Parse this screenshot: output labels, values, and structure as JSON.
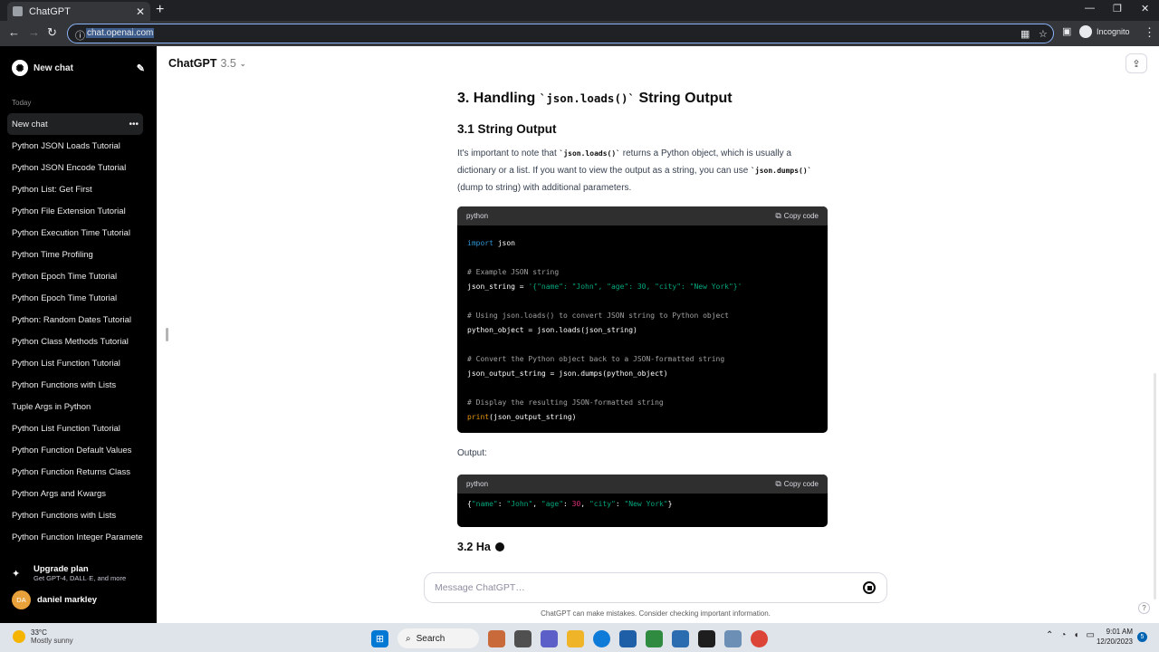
{
  "browser": {
    "tab_title": "ChatGPT",
    "url": "chat.openai.com",
    "profile_label": "Incognito"
  },
  "sidebar": {
    "new_chat_label": "New chat",
    "today_label": "Today",
    "items": [
      {
        "label": "New chat"
      },
      {
        "label": "Python JSON Loads Tutorial"
      },
      {
        "label": "Python JSON Encode Tutorial"
      },
      {
        "label": "Python List: Get First"
      },
      {
        "label": "Python File Extension Tutorial"
      },
      {
        "label": "Python Execution Time Tutorial"
      },
      {
        "label": "Python Time Profiling"
      },
      {
        "label": "Python Epoch Time Tutorial"
      },
      {
        "label": "Python Epoch Time Tutorial"
      },
      {
        "label": "Python: Random Dates Tutorial"
      },
      {
        "label": "Python Class Methods Tutorial"
      },
      {
        "label": "Python List Function Tutorial"
      },
      {
        "label": "Python Functions with Lists"
      },
      {
        "label": "Tuple Args in Python"
      },
      {
        "label": "Python List Function Tutorial"
      },
      {
        "label": "Python Function Default Values"
      },
      {
        "label": "Python Function Returns Class"
      },
      {
        "label": "Python Args and Kwargs"
      },
      {
        "label": "Python Functions with Lists"
      },
      {
        "label": "Python Function Integer Parameter"
      }
    ],
    "upgrade_title": "Upgrade plan",
    "upgrade_subtitle": "Get GPT-4, DALL·E, and more",
    "user_initials": "DA",
    "user_name": "daniel markley"
  },
  "header": {
    "model_name": "ChatGPT",
    "model_version": "3.5"
  },
  "article": {
    "h3_prefix": "3. Handling ",
    "h3_code": "`json.loads()`",
    "h3_suffix": " String Output",
    "h31": "3.1 String Output",
    "p_1": "It's important to note that ",
    "p_code1": "`json.loads()`",
    "p_2": " returns a Python object, which is usually a dictionary or a list. If you want to view the output as a string, you can use ",
    "p_code2": "`json.dumps()`",
    "p_3": " (dump to string) with additional parameters.",
    "output_label": "Output:",
    "h32": "3.2 Ha"
  },
  "code1": {
    "lang": "python",
    "copy_label": "Copy code",
    "l1_kw": "import",
    "l1_rest": " json",
    "l3": "# Example JSON string",
    "l4_a": "json_string = ",
    "l4_str": "'{\"name\": \"John\", \"age\": 30, \"city\": \"New York\"}'",
    "l6": "# Using json.loads() to convert JSON string to Python object",
    "l7": "python_object = json.loads(json_string)",
    "l9": "# Convert the Python object back to a JSON-formatted string",
    "l10": "json_output_string = json.dumps(python_object)",
    "l12": "# Display the resulting JSON-formatted string",
    "l13_fn": "print",
    "l13_rest": "(json_output_string)"
  },
  "code2": {
    "lang": "python",
    "copy_label": "Copy code",
    "o_open": "{",
    "o_k1": "\"name\"",
    "o_c1": ": ",
    "o_v1": "\"John\"",
    "o_s1": ", ",
    "o_k2": "\"age\"",
    "o_c2": ": ",
    "o_v2": "30",
    "o_s2": ", ",
    "o_k3": "\"city\"",
    "o_c3": ": ",
    "o_v3": "\"New York\"",
    "o_close": "}"
  },
  "composer": {
    "placeholder": "Message ChatGPT…",
    "disclaimer": "ChatGPT can make mistakes. Consider checking important information."
  },
  "taskbar": {
    "temp": "33°C",
    "weather": "Mostly sunny",
    "search_label": "Search",
    "time": "9:01 AM",
    "date": "12/20/2023",
    "notif_count": "5"
  }
}
